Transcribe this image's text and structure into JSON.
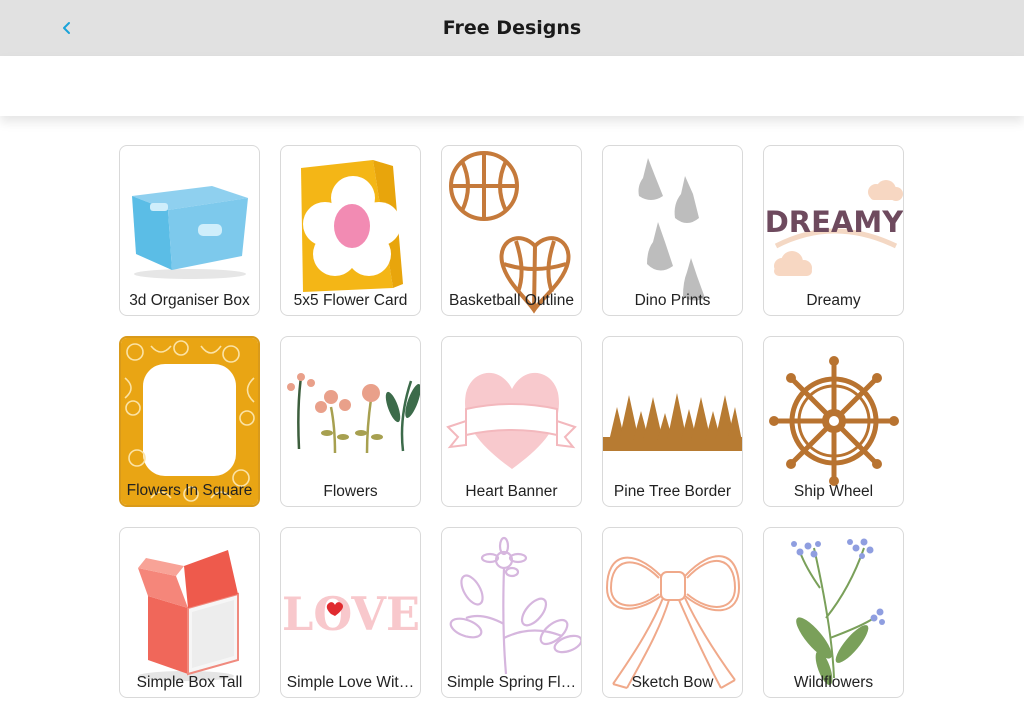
{
  "header": {
    "title": "Free Designs",
    "back_icon": "chevron-left-icon",
    "accent": "#1aa3d9"
  },
  "designs": [
    {
      "label": "3d Organiser Box"
    },
    {
      "label": "5x5 Flower Card"
    },
    {
      "label": "Basketball Outline"
    },
    {
      "label": "Dino Prints"
    },
    {
      "label": "Dreamy",
      "art_text": "DREAMY"
    },
    {
      "label": "Flowers In Square",
      "selected": true
    },
    {
      "label": "Flowers"
    },
    {
      "label": "Heart Banner"
    },
    {
      "label": "Pine Tree Border"
    },
    {
      "label": "Ship Wheel"
    },
    {
      "label": "Simple Box Tall"
    },
    {
      "label": "Simple Love Wit…",
      "art_text": "LOVE"
    },
    {
      "label": "Simple Spring Fl…"
    },
    {
      "label": "Sketch Bow"
    },
    {
      "label": "Wildflowers"
    }
  ]
}
